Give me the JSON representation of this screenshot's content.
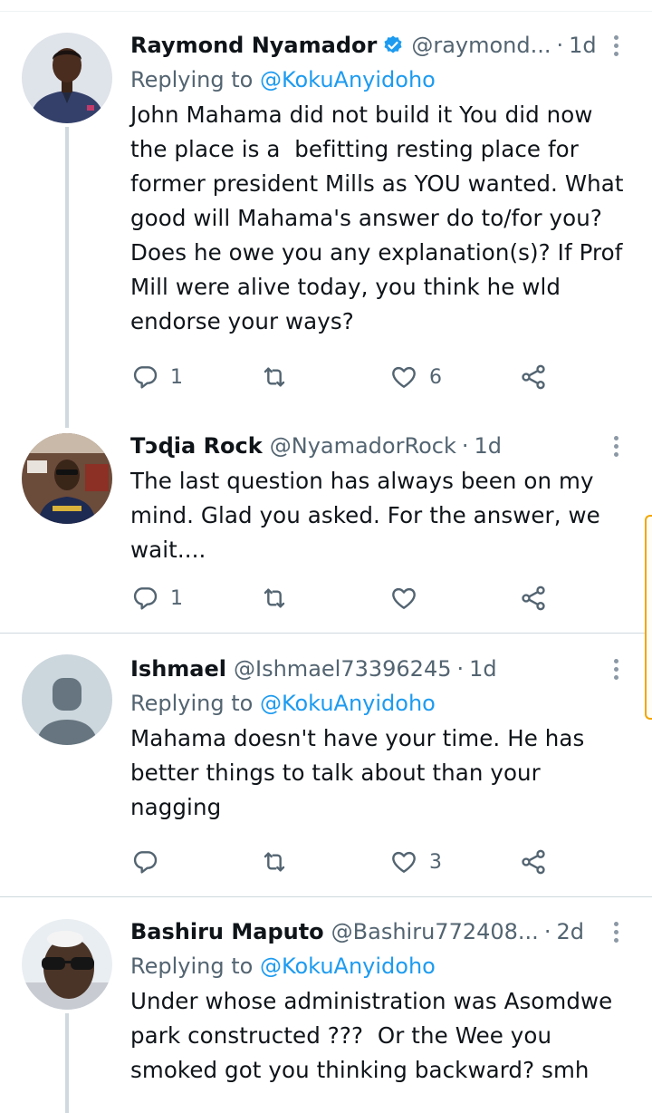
{
  "tweets": [
    {
      "name": "Raymond Nyamador",
      "handle": "@raymond...",
      "time": "1d",
      "replying_prefix": "Replying to ",
      "replying_to": "@KokuAnyidoho",
      "text": "John Mahama did not build it You did now the place is a  befitting resting place for former president Mills as YOU wanted. What good will Mahama's answer do to/for you? Does he owe you any explanation(s)? If Prof Mill were alive today, you think he wld endorse your ways?",
      "replies": "1",
      "retweets": "",
      "likes": "6",
      "verified": true
    },
    {
      "name": "Tɔɖia Rock",
      "handle": "@NyamadorRock",
      "time": "1d",
      "text": "The last question has always been on my mind. Glad you asked. For the answer, we wait....",
      "replies": "1",
      "retweets": "",
      "likes": ""
    },
    {
      "name": "Ishmael",
      "handle": "@Ishmael73396245",
      "time": "1d",
      "replying_prefix": "Replying to ",
      "replying_to": "@KokuAnyidoho",
      "text": "Mahama doesn't have your time. He has better things to talk about than your nagging",
      "replies": "",
      "retweets": "",
      "likes": "3"
    },
    {
      "name": "Bashiru Maputo",
      "handle": "@Bashiru772408...",
      "time": "2d",
      "replying_prefix": "Replying to ",
      "replying_to": "@KokuAnyidoho",
      "text": "Under whose administration was Asomdwe park constructed ???  Or the Wee you smoked got you thinking backward? smh"
    }
  ],
  "separator": "·",
  "icons": {
    "reply": "reply-icon",
    "retweet": "retweet-icon",
    "like": "heart-icon",
    "share": "share-icon",
    "more": "more-options-icon",
    "verified": "verified-badge-icon"
  },
  "colors": {
    "link": "#1d9bf0",
    "secondary_text": "#536471",
    "primary_text": "#0f1419",
    "divider": "#cfd9de",
    "thread_line": "#cfd9de",
    "scroll_thumb": "#f2a600"
  }
}
